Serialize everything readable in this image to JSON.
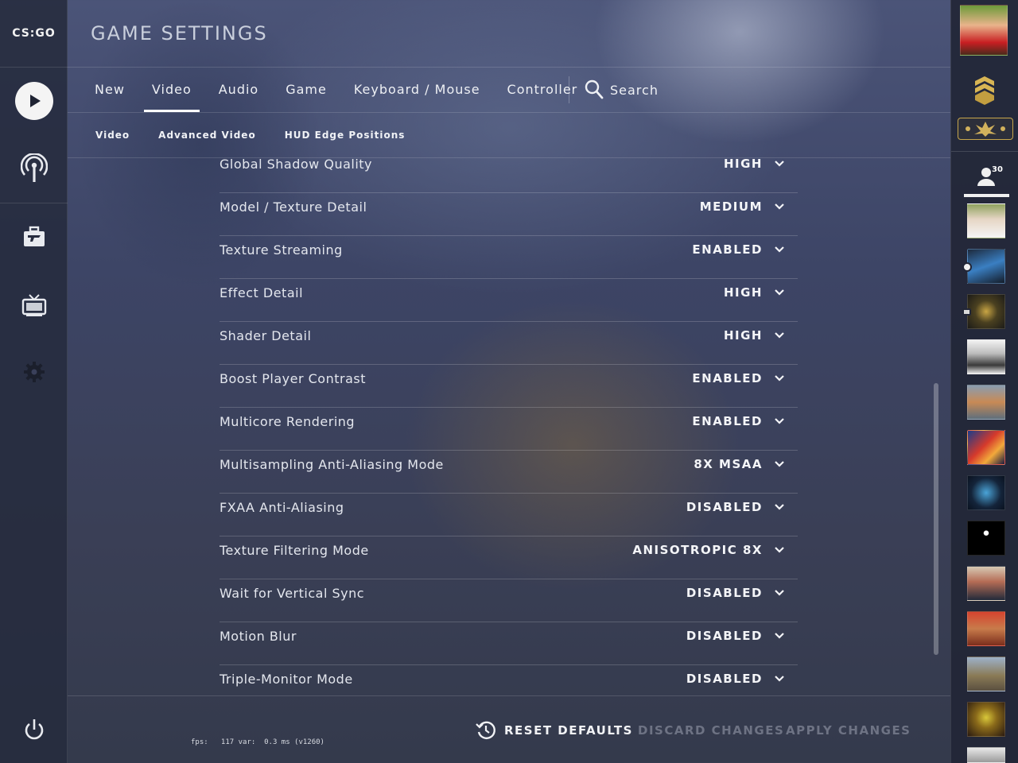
{
  "app": {
    "logo_text": "CS:GO"
  },
  "header": {
    "title": "GAME SETTINGS"
  },
  "tabs": [
    {
      "label": "New"
    },
    {
      "label": "Video",
      "active": true
    },
    {
      "label": "Audio"
    },
    {
      "label": "Game"
    },
    {
      "label": "Keyboard / Mouse"
    },
    {
      "label": "Controller"
    }
  ],
  "search": {
    "label": "Search"
  },
  "subtabs": [
    {
      "label": "Video"
    },
    {
      "label": "Advanced Video"
    },
    {
      "label": "HUD Edge Positions"
    }
  ],
  "settings": [
    {
      "label": "Global Shadow Quality",
      "value": "HIGH"
    },
    {
      "label": "Model / Texture Detail",
      "value": "MEDIUM"
    },
    {
      "label": "Texture Streaming",
      "value": "ENABLED"
    },
    {
      "label": "Effect Detail",
      "value": "HIGH"
    },
    {
      "label": "Shader Detail",
      "value": "HIGH"
    },
    {
      "label": "Boost Player Contrast",
      "value": "ENABLED"
    },
    {
      "label": "Multicore Rendering",
      "value": "ENABLED"
    },
    {
      "label": "Multisampling Anti-Aliasing Mode",
      "value": "8X MSAA"
    },
    {
      "label": "FXAA Anti-Aliasing",
      "value": "DISABLED"
    },
    {
      "label": "Texture Filtering Mode",
      "value": "ANISOTROPIC 8X"
    },
    {
      "label": "Wait for Vertical Sync",
      "value": "DISABLED"
    },
    {
      "label": "Motion Blur",
      "value": "DISABLED"
    },
    {
      "label": "Triple-Monitor Mode",
      "value": "DISABLED"
    }
  ],
  "footer": {
    "fps_text": "fps:   117 var:  0.3 ms (v1260)",
    "reset_label": "RESET DEFAULTS",
    "discard_label": "DISCARD CHANGES",
    "apply_label": "APPLY CHANGES"
  },
  "friends": {
    "count": "30"
  },
  "colors": {
    "accent": "#ffffff",
    "disabled_text": "#6e7384",
    "panel_bg": "#262b3e"
  },
  "icons": {
    "left_nav": [
      "play-icon",
      "broadcast-icon",
      "inventory-icon",
      "tv-icon",
      "settings-gear-icon",
      "power-icon"
    ],
    "right_panel": [
      "profile-avatar",
      "rank-chevron-icon",
      "rank-badge-icon",
      "friends-icon"
    ]
  }
}
